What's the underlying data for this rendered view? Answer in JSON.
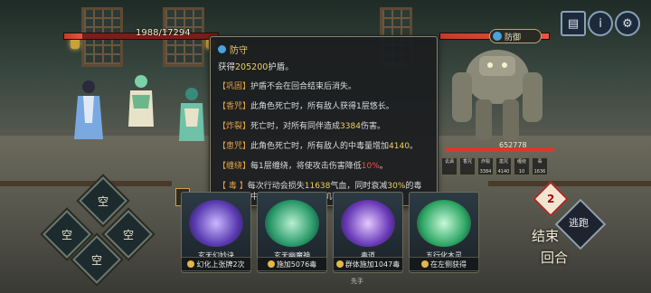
{
  "battle": {
    "player_hp": "1988/17294",
    "boss_label": "防御",
    "boss_hp": "652778"
  },
  "boss_buffs": [
    {
      "name": "讥讽",
      "value": ""
    },
    {
      "name": "香咒",
      "value": ""
    },
    {
      "name": "炸裂",
      "value": "3384"
    },
    {
      "name": "患咒",
      "value": "4140"
    },
    {
      "name": "缠绕",
      "value": "10"
    },
    {
      "name": "毒",
      "value": "1636"
    }
  ],
  "tooltip": {
    "title": "防守",
    "subtitle_pre": "获得",
    "subtitle_num": "205200",
    "subtitle_post": "护盾。",
    "rows": [
      {
        "tag": "【巩固】",
        "text": "护盾不会在回合结束后消失。"
      },
      {
        "tag": "【香咒】",
        "text": "此角色死亡时，所有敌人获得1层悠长。"
      },
      {
        "tag": "【炸裂】",
        "pre": "死亡时，对所有同伴造成",
        "num": "3384",
        "post": "伤害。"
      },
      {
        "tag": "【患咒】",
        "pre": "此角色死亡时，所有敌人的中毒量增加",
        "num": "4140",
        "post": "。"
      },
      {
        "tag": "【缠绕】",
        "pre": "每1层缠绕，将使攻击伤害降低",
        "num": "10%",
        "post": "。"
      },
      {
        "tag": "【 毒 】",
        "pre": "每次行动会损失",
        "num": "11638",
        "mid": "气血，同时衰减",
        "num2": "30%",
        "post": "的毒量。如果中毒者死亡，毒将随机转移给同伴。"
      }
    ]
  },
  "slots": [
    "空",
    "空",
    "空",
    "空"
  ],
  "cards": [
    {
      "name": "玄天幻妙诀",
      "desc": "幻化上张牌2次",
      "color": "#7b6ad8"
    },
    {
      "name": "玄天幽魔神",
      "desc": "施加5076毒",
      "color": "#38b27a"
    },
    {
      "name": "毒道",
      "desc": "群体施加1047毒",
      "color": "#7b4ad0"
    },
    {
      "name": "五行化木灵",
      "desc": "在左侧获得",
      "color": "#3cb873"
    }
  ],
  "right_panel": {
    "turn_number": "2",
    "flee": "逃跑",
    "end_turn_1": "结束",
    "end_turn_2": "回合"
  },
  "footer_text": "先手",
  "icons": [
    "book-icon",
    "info-icon",
    "gear-icon",
    "shield-icon"
  ],
  "colors": {
    "accent": "#e8c76a",
    "hp": "#d63a2c",
    "tag": "#e6a245"
  }
}
